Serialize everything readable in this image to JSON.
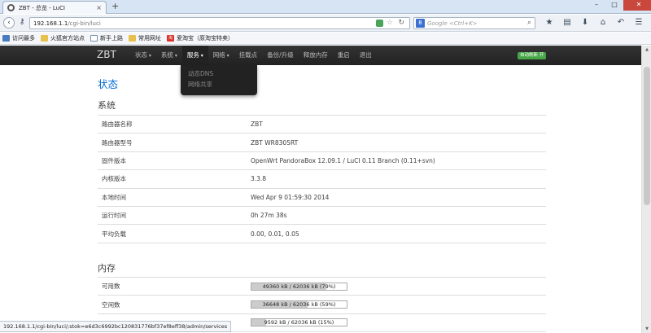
{
  "browser": {
    "tab_title": "ZBT - 总览 - LuCI",
    "tab_close": "×",
    "new_tab": "+",
    "url_host": "192.168.1.1",
    "url_path": "/cgi-bin/luci",
    "search_placeholder": "Google <Ctrl+K>",
    "search_engine_glyph": "8",
    "window_controls": [
      "–",
      "□",
      "✕"
    ],
    "nav_icons": [
      "back-icon",
      "key-icon"
    ],
    "toolbar_icons": [
      "star",
      "bookmark-list",
      "download",
      "home",
      "undo",
      "menu"
    ],
    "toolbar_glyphs": [
      "★",
      "▤",
      "⬇",
      "⌂",
      "↶",
      "☰"
    ],
    "status_url": "192.168.1.1/cgi-bin/luci/;stok=e6d3c6992bc120831776bf37ef8eff38/admin/services"
  },
  "bookmarks": [
    {
      "label": "访问最多",
      "icon": "blue"
    },
    {
      "label": "火狐官方站点",
      "icon": "folder"
    },
    {
      "label": "新手上路",
      "icon": "page"
    },
    {
      "label": "常用网址",
      "icon": "folder"
    },
    {
      "label": "爱淘宝（原淘宝特卖）",
      "icon": "red",
      "glyph": "淘"
    }
  ],
  "luci": {
    "brand": "ZBT",
    "menu": [
      {
        "label": "状态",
        "caret": true,
        "active": false
      },
      {
        "label": "系统",
        "caret": true,
        "active": false
      },
      {
        "label": "服务",
        "caret": true,
        "active": true
      },
      {
        "label": "网络",
        "caret": true,
        "active": false
      },
      {
        "label": "挂载点",
        "caret": false,
        "active": false
      },
      {
        "label": "备份/升级",
        "caret": false,
        "active": false
      },
      {
        "label": "释放内存",
        "caret": false,
        "active": false
      },
      {
        "label": "重启",
        "caret": false,
        "active": false
      },
      {
        "label": "退出",
        "caret": false,
        "active": false
      }
    ],
    "autorefresh": "自动刷新 开",
    "dropdown": [
      "动态DNS",
      "网络共享"
    ]
  },
  "page": {
    "title": "状态",
    "system": {
      "heading": "系统",
      "rows": [
        {
          "key": "路由器名称",
          "value": "ZBT"
        },
        {
          "key": "路由器型号",
          "value": "ZBT WR8305RT"
        },
        {
          "key": "固件版本",
          "value": "OpenWrt PandoraBox 12.09.1 / LuCI 0.11 Branch (0.11+svn)"
        },
        {
          "key": "内核版本",
          "value": "3.3.8"
        },
        {
          "key": "本地时间",
          "value": "Wed Apr 9 01:59:30 2014"
        },
        {
          "key": "运行时间",
          "value": "0h 27m 38s"
        },
        {
          "key": "平均负载",
          "value": "0.00, 0.01, 0.05"
        }
      ]
    },
    "memory": {
      "heading": "内存",
      "rows": [
        {
          "key": "可用数",
          "label": "49360 kB / 62036 kB (79%)",
          "percent": 79
        },
        {
          "key": "空闲数",
          "label": "36648 kB / 62036 kB (59%)",
          "percent": 59
        },
        {
          "key": "",
          "label": "9592 kB / 62036 kB (15%)",
          "percent": 15
        }
      ]
    }
  }
}
